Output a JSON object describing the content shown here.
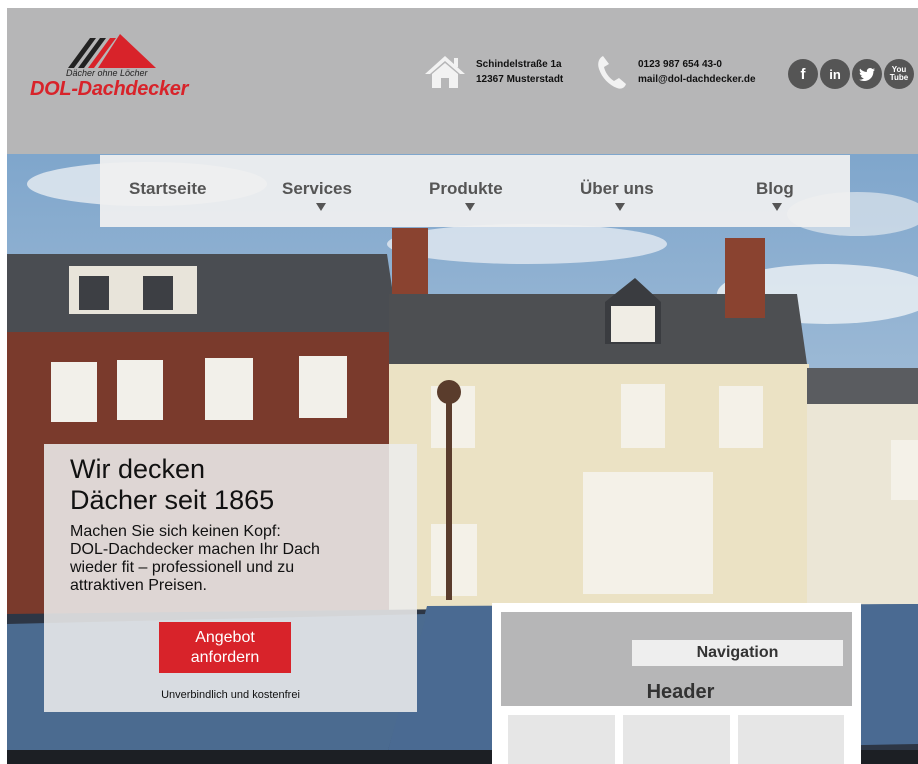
{
  "header": {
    "logo_tagline": "Dächer ohne Löcher",
    "logo_name": "DOL-Dachdecker",
    "address_line1": "Schindelstraße 1a",
    "address_line2": "12367 Musterstadt",
    "phone": "0123 987 654 43-0",
    "email": "mail@dol-dachdecker.de",
    "social": [
      {
        "icon": "facebook-icon",
        "glyph": "f"
      },
      {
        "icon": "linkedin-icon",
        "glyph": "in"
      },
      {
        "icon": "twitter-icon",
        "glyph": "t"
      },
      {
        "icon": "youtube-icon",
        "glyph": "You\nTube"
      }
    ]
  },
  "nav": {
    "items": [
      {
        "label": "Startseite",
        "has_dropdown": false
      },
      {
        "label": "Services",
        "has_dropdown": true
      },
      {
        "label": "Produkte",
        "has_dropdown": true
      },
      {
        "label": "Über uns",
        "has_dropdown": true
      },
      {
        "label": "Blog",
        "has_dropdown": true
      }
    ]
  },
  "promo": {
    "title": "Wir decken\nDächer seit 1865",
    "text": "Machen Sie sich keinen Kopf:\nDOL-Dachdecker machen Ihr Dach\nwieder fit – professionell und zu\nattraktiven Preisen.",
    "button_label": "Angebot\nanfordern",
    "note": "Unverbindlich und kostenfrei"
  },
  "wireframe": {
    "nav_label": "Navigation",
    "header_label": "Header"
  },
  "colors": {
    "brand_red": "#d8232a",
    "header_gray": "#b6b6b7",
    "icon_gray": "#555555"
  }
}
